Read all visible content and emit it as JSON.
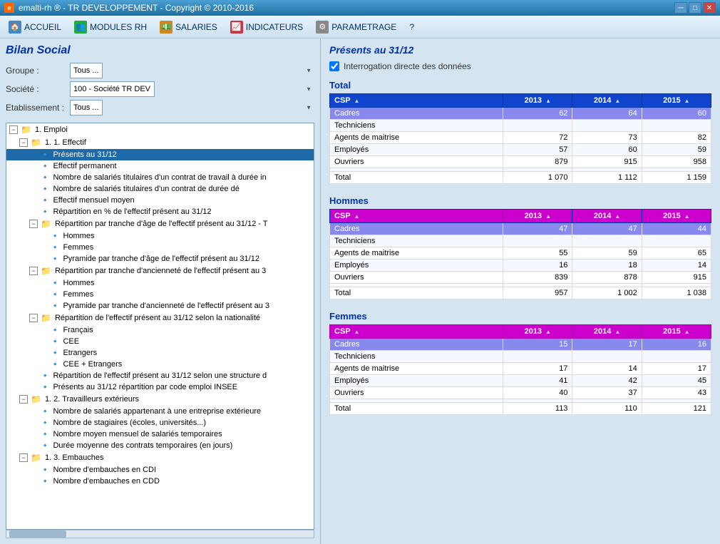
{
  "titlebar": {
    "title": "emalti-rh ® - TR DEVELOPPEMENT - Copyright © 2010-2016"
  },
  "menu": {
    "items": [
      {
        "id": "accueil",
        "label": "ACCUEIL",
        "icon": "🏠"
      },
      {
        "id": "modules-rh",
        "label": "MODULES RH",
        "icon": "👥"
      },
      {
        "id": "salaries",
        "label": "SALARIES",
        "icon": "💰"
      },
      {
        "id": "indicateurs",
        "label": "INDICATEURS",
        "icon": "📊"
      },
      {
        "id": "parametrage",
        "label": "PARAMETRAGE",
        "icon": "⚙"
      },
      {
        "id": "help",
        "label": "?",
        "icon": ""
      }
    ]
  },
  "left_panel": {
    "page_title": "Bilan Social",
    "groupe_label": "Groupe :",
    "groupe_value": "Tous ...",
    "societe_label": "Société :",
    "societe_value": "100 - Société TR DEV",
    "etablissement_label": "Etablissement :",
    "etablissement_value": "Tous ...",
    "tree": [
      {
        "indent": 0,
        "type": "expandable",
        "expanded": true,
        "icon": "folder",
        "text": "1. Emploi"
      },
      {
        "indent": 1,
        "type": "expandable",
        "expanded": true,
        "icon": "folder",
        "text": "1. 1. Effectif"
      },
      {
        "indent": 2,
        "type": "leaf",
        "selected": true,
        "icon": "leaf",
        "text": "Présents au 31/12"
      },
      {
        "indent": 2,
        "type": "leaf",
        "icon": "leaf",
        "text": "Effectif permanent"
      },
      {
        "indent": 2,
        "type": "leaf",
        "icon": "leaf",
        "text": "Nombre de salariés titulaires d'un contrat de travail à durée in"
      },
      {
        "indent": 2,
        "type": "leaf",
        "icon": "leaf",
        "text": "Nombre de salariés titulaires d'un contrat de durée dé"
      },
      {
        "indent": 2,
        "type": "leaf",
        "icon": "leaf",
        "text": "Effectif mensuel moyen"
      },
      {
        "indent": 2,
        "type": "leaf",
        "icon": "leaf",
        "text": "Répartition en % de l'effectif présent au 31/12"
      },
      {
        "indent": 2,
        "type": "expandable",
        "expanded": true,
        "icon": "folder",
        "text": "Répartition par tranche d'âge de l'effectif présent au 31/12 - T"
      },
      {
        "indent": 3,
        "type": "leaf",
        "icon": "leaf",
        "text": "Hommes"
      },
      {
        "indent": 3,
        "type": "leaf",
        "icon": "leaf",
        "text": "Femmes"
      },
      {
        "indent": 3,
        "type": "leaf",
        "icon": "leaf",
        "text": "Pyramide par tranche d'âge de l'effectif présent au 31/12"
      },
      {
        "indent": 2,
        "type": "expandable",
        "expanded": true,
        "icon": "folder",
        "text": "Répartition par tranche d'ancienneté de l'effectif présent au 3"
      },
      {
        "indent": 3,
        "type": "leaf",
        "icon": "leaf",
        "text": "Hommes"
      },
      {
        "indent": 3,
        "type": "leaf",
        "icon": "leaf",
        "text": "Femmes"
      },
      {
        "indent": 3,
        "type": "leaf",
        "icon": "leaf",
        "text": "Pyramide par tranche d'ancienneté de l'effectif présent au 3"
      },
      {
        "indent": 2,
        "type": "expandable",
        "expanded": true,
        "icon": "folder",
        "text": "Répartition de l'effectif présent au 31/12 selon la nationalité"
      },
      {
        "indent": 3,
        "type": "leaf",
        "icon": "leaf",
        "text": "Français"
      },
      {
        "indent": 3,
        "type": "leaf",
        "icon": "leaf",
        "text": "CEE"
      },
      {
        "indent": 3,
        "type": "leaf",
        "icon": "leaf",
        "text": "Etrangers"
      },
      {
        "indent": 3,
        "type": "leaf",
        "icon": "leaf",
        "text": "CEE + Etrangers"
      },
      {
        "indent": 2,
        "type": "leaf",
        "icon": "leaf",
        "text": "Répartition de l'effectif présent au 31/12 selon une structure d"
      },
      {
        "indent": 2,
        "type": "leaf",
        "icon": "leaf",
        "text": "Présents au 31/12 répartition par code emploi INSEE"
      },
      {
        "indent": 1,
        "type": "expandable",
        "expanded": true,
        "icon": "folder",
        "text": "1. 2. Travailleurs extérieurs"
      },
      {
        "indent": 2,
        "type": "leaf",
        "icon": "leaf",
        "text": "Nombre de salariés appartenant à une entreprise extérieure"
      },
      {
        "indent": 2,
        "type": "leaf",
        "icon": "leaf",
        "text": "Nombre de stagiaires (écoles, universités...)"
      },
      {
        "indent": 2,
        "type": "leaf",
        "icon": "leaf",
        "text": "Nombre moyen mensuel de salariés temporaires"
      },
      {
        "indent": 2,
        "type": "leaf",
        "icon": "leaf",
        "text": "Durée moyenne des contrats temporaires (en jours)"
      },
      {
        "indent": 1,
        "type": "expandable",
        "expanded": true,
        "icon": "folder",
        "text": "1. 3. Embauches"
      },
      {
        "indent": 2,
        "type": "leaf",
        "icon": "leaf",
        "text": "Nombre d'embauches en CDI"
      },
      {
        "indent": 2,
        "type": "leaf",
        "icon": "leaf",
        "text": "Nombre d'embauches en CDD"
      }
    ]
  },
  "right_panel": {
    "section_title": "Présents au 31/12",
    "checkbox_label": "Interrogation directe des données",
    "checkbox_checked": true,
    "total_section": {
      "title": "Total",
      "headers": [
        "CSP",
        "2013",
        "2014",
        "2015"
      ],
      "rows": [
        {
          "label": "Cadres",
          "highlight": true,
          "v2013": "62",
          "v2014": "64",
          "v2015": "60"
        },
        {
          "label": "Techniciens",
          "highlight": false,
          "v2013": "",
          "v2014": "",
          "v2015": ""
        },
        {
          "label": "Agents de maitrise",
          "highlight": false,
          "v2013": "72",
          "v2014": "73",
          "v2015": "82"
        },
        {
          "label": "Employés",
          "highlight": false,
          "v2013": "57",
          "v2014": "60",
          "v2015": "59"
        },
        {
          "label": "Ouvriers",
          "highlight": false,
          "v2013": "879",
          "v2014": "915",
          "v2015": "958"
        },
        {
          "label": "",
          "highlight": false,
          "v2013": "",
          "v2014": "",
          "v2015": ""
        },
        {
          "label": "Total",
          "highlight": false,
          "total": true,
          "v2013": "1 070",
          "v2014": "1 112",
          "v2015": "1 159"
        }
      ]
    },
    "hommes_section": {
      "title": "Hommes",
      "headers": [
        "CSP",
        "2013",
        "2014",
        "2015"
      ],
      "rows": [
        {
          "label": "Cadres",
          "highlight": true,
          "v2013": "47",
          "v2014": "47",
          "v2015": "44"
        },
        {
          "label": "Techniciens",
          "highlight": false,
          "v2013": "",
          "v2014": "",
          "v2015": ""
        },
        {
          "label": "Agents de maitrise",
          "highlight": false,
          "v2013": "55",
          "v2014": "59",
          "v2015": "65"
        },
        {
          "label": "Employés",
          "highlight": false,
          "v2013": "16",
          "v2014": "18",
          "v2015": "14"
        },
        {
          "label": "Ouvriers",
          "highlight": false,
          "v2013": "839",
          "v2014": "878",
          "v2015": "915"
        },
        {
          "label": "",
          "highlight": false,
          "v2013": "",
          "v2014": "",
          "v2015": ""
        },
        {
          "label": "Total",
          "highlight": false,
          "total": true,
          "v2013": "957",
          "v2014": "1 002",
          "v2015": "1 038"
        }
      ]
    },
    "femmes_section": {
      "title": "Femmes",
      "headers": [
        "CSP",
        "2013",
        "2014",
        "2015"
      ],
      "rows": [
        {
          "label": "Cadres",
          "highlight": true,
          "v2013": "15",
          "v2014": "17",
          "v2015": "16"
        },
        {
          "label": "Techniciens",
          "highlight": false,
          "v2013": "",
          "v2014": "",
          "v2015": ""
        },
        {
          "label": "Agents de maitrise",
          "highlight": false,
          "v2013": "17",
          "v2014": "14",
          "v2015": "17"
        },
        {
          "label": "Employés",
          "highlight": false,
          "v2013": "41",
          "v2014": "42",
          "v2015": "45"
        },
        {
          "label": "Ouvriers",
          "highlight": false,
          "v2013": "40",
          "v2014": "37",
          "v2015": "43"
        },
        {
          "label": "",
          "highlight": false,
          "v2013": "",
          "v2014": "",
          "v2015": ""
        },
        {
          "label": "Total",
          "highlight": false,
          "total": true,
          "v2013": "113",
          "v2014": "110",
          "v2015": "121"
        }
      ]
    }
  },
  "icons": {
    "folder_open": "📁",
    "folder_closed": "📁",
    "leaf": "🔶",
    "checkbox_checked": "☑",
    "minimize": "─",
    "maximize": "□",
    "close": "✕",
    "sort": "⬆"
  }
}
